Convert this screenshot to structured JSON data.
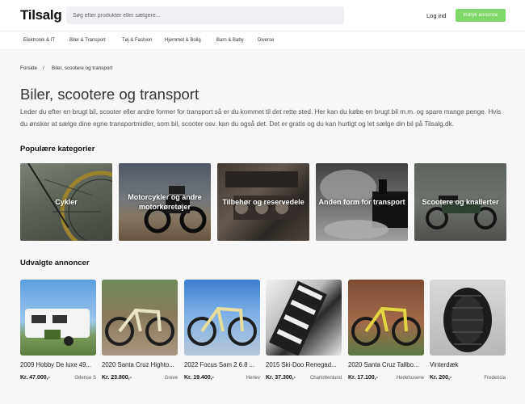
{
  "header": {
    "logo": "Tilsalg",
    "search_placeholder": "Søg efter produkter eller sælgere...",
    "login": "Log ind",
    "cta": "Indryk annonce"
  },
  "categories_nav": [
    "Elektronik & IT",
    "Biler & Transport",
    "Tøj & Fashion",
    "Hjemmet & Bolig",
    "Barn & Baby",
    "Diverse"
  ],
  "breadcrumb": {
    "home": "Forside",
    "separator": "/",
    "current": "Biler, scootere og transport"
  },
  "page": {
    "title": "Biler, scootere og transport",
    "intro": "Leder du efter en brugt bil, scooter eller andre former for transport så er du kommet til det rette sted. Her kan du købe en brugt bil m.m. og spare mange penge. Hvis du ønsker at sælge dine egne transportmidler, som bil, scooter osv. kan du også det. Det er gratis og du kan hurtigt og let sælge din bil på Tilsalg.dk."
  },
  "popular": {
    "heading": "Populære kategorier",
    "tiles": [
      {
        "label": "Cykler",
        "icon": "bicycle-photo"
      },
      {
        "label": "Motorcykler og andre motorkøretøjer",
        "icon": "motorcycle-photo"
      },
      {
        "label": "Tilbehør og reservedele",
        "icon": "engine-parts-photo"
      },
      {
        "label": "Anden form for transport",
        "icon": "steam-train-photo"
      },
      {
        "label": "Scootere og knallerter",
        "icon": "moped-photo"
      }
    ]
  },
  "listings": {
    "heading": "Udvalgte annoncer",
    "items": [
      {
        "title": "2009 Hobby De luxe 49...",
        "price": "Kr. 47.000,-",
        "location": "Odense S",
        "icon": "caravan-photo"
      },
      {
        "title": "2020 Santa Cruz Highto...",
        "price": "Kr. 23.800,-",
        "location": "Greve",
        "icon": "mountain-bike-photo"
      },
      {
        "title": "2022 Focus Sam 2 6.8 ...",
        "price": "Kr. 19.400,-",
        "location": "Herlev",
        "icon": "mountain-bike-photo"
      },
      {
        "title": "2015 Ski-Doo Renegad...",
        "price": "Kr. 37.300,-",
        "location": "Charlottenlund",
        "icon": "snowmobile-track-photo"
      },
      {
        "title": "2020 Santa Cruz Tallbo...",
        "price": "Kr. 17.100,-",
        "location": "Hedehusene",
        "icon": "mountain-bike-photo"
      },
      {
        "title": "Vinterdæk",
        "price": "Kr. 200,-",
        "location": "Fredericia",
        "icon": "tire-photo"
      }
    ]
  },
  "colors": {
    "accent": "#7ed96a",
    "background": "#f7f7f8",
    "search_bg": "#eef0f3"
  }
}
